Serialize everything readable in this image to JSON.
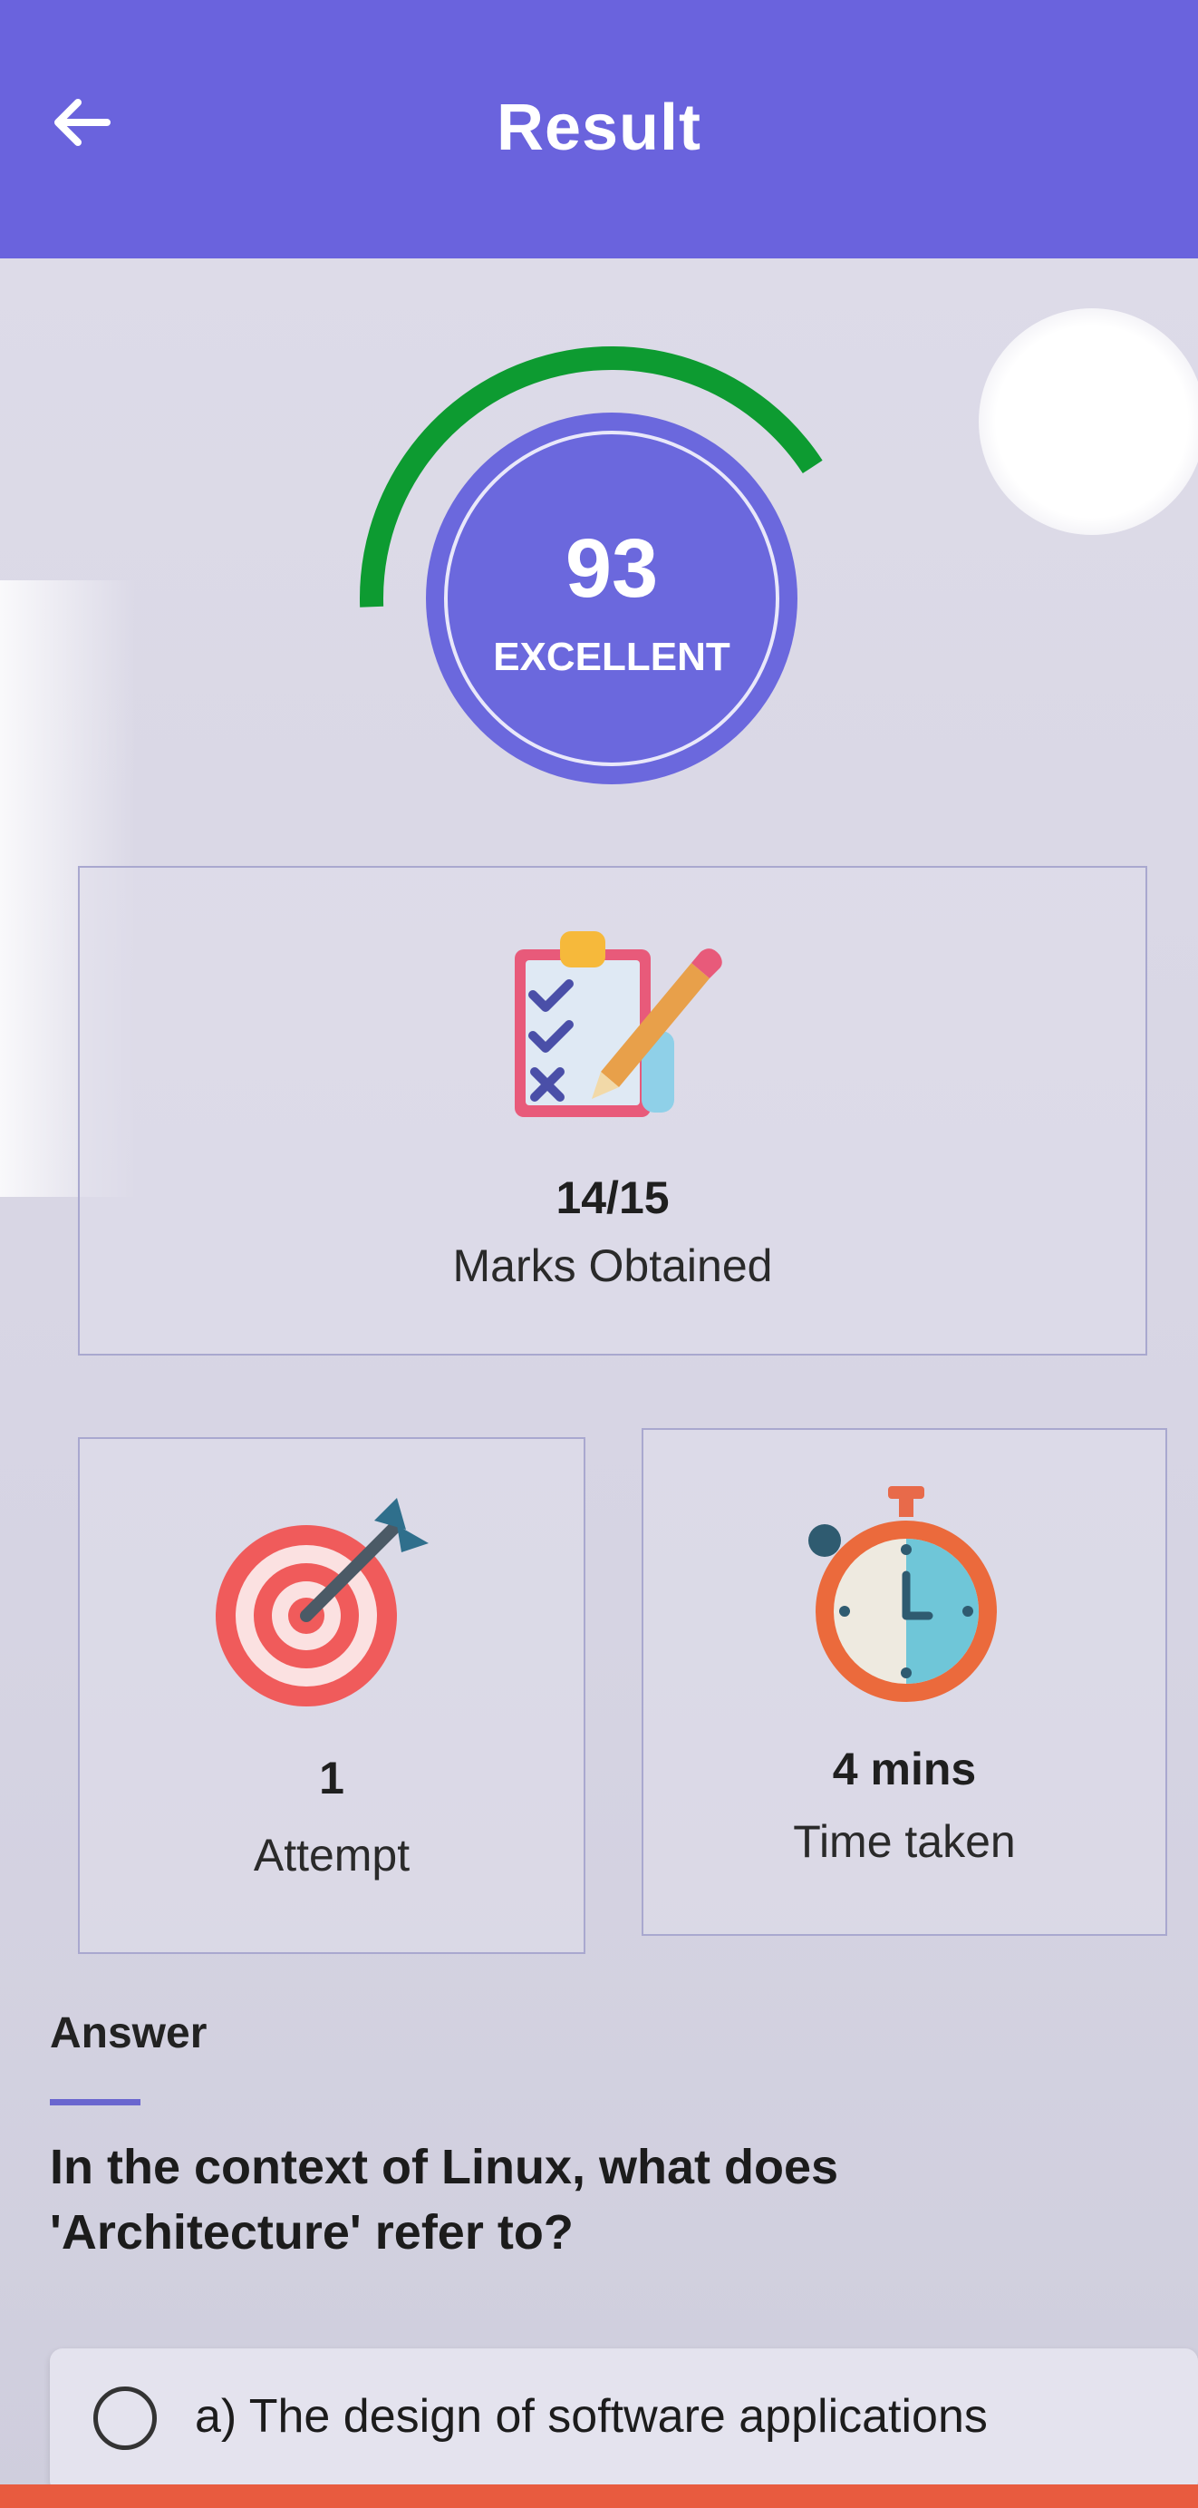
{
  "appbar": {
    "title": "Result",
    "back_icon": "arrow-left-icon",
    "color": "#6a63dd"
  },
  "score": {
    "value": "93",
    "rating": "EXCELLENT",
    "gauge_fraction": 0.93,
    "gauge_color": "#0d9b31",
    "circle_color": "#6b68dd"
  },
  "marks": {
    "value": "14/15",
    "label": "Marks Obtained",
    "icon": "clipboard-checklist-icon"
  },
  "attempt": {
    "value": "1",
    "label": "Attempt",
    "icon": "target-dart-icon"
  },
  "time": {
    "value": "4 mins",
    "label": "Time taken",
    "icon": "stopwatch-icon"
  },
  "answer": {
    "heading": "Answer",
    "accent_color": "#6a66cf",
    "question": "In the context of Linux, what does 'Architecture' refer to?",
    "options": [
      {
        "text": "a) The design of software applications"
      }
    ]
  }
}
